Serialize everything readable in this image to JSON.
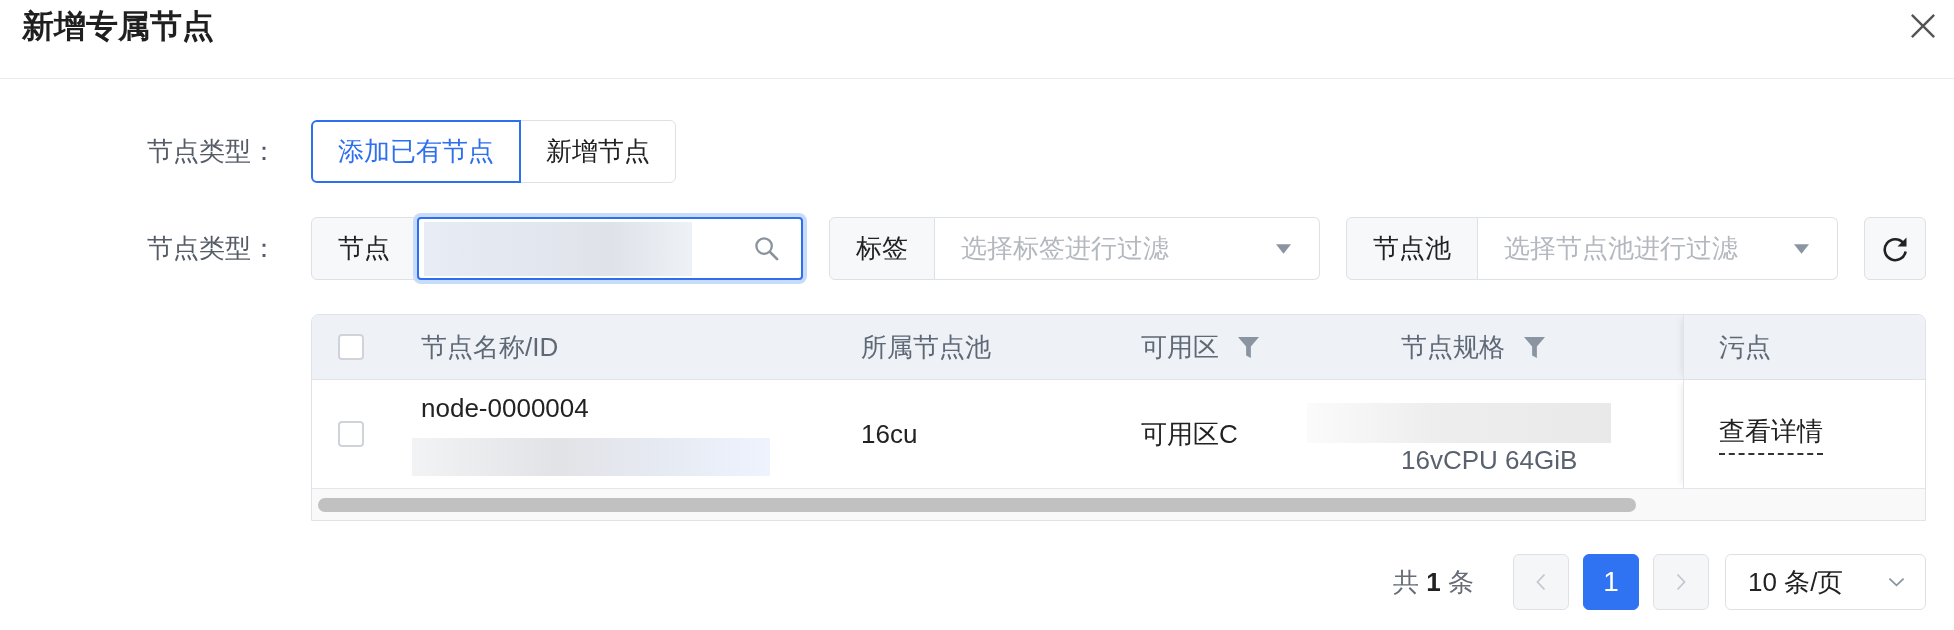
{
  "dialog": {
    "title": "新增专属节点"
  },
  "node_type": {
    "label": "节点类型：",
    "options": [
      {
        "label": "添加已有节点",
        "selected": true
      },
      {
        "label": "新增节点",
        "selected": false
      }
    ]
  },
  "filters": {
    "label": "节点类型：",
    "node": {
      "addon": "节点",
      "focused": true,
      "value_blurred": true
    },
    "tag": {
      "addon": "标签",
      "placeholder": "选择标签进行过滤"
    },
    "pool": {
      "addon": "节点池",
      "placeholder": "选择节点池进行过滤"
    }
  },
  "table": {
    "header_checked": false,
    "columns": [
      {
        "label": "节点名称/ID",
        "filterable": false
      },
      {
        "label": "所属节点池",
        "filterable": false
      },
      {
        "label": "可用区",
        "filterable": true
      },
      {
        "label": "节点规格",
        "filterable": true
      },
      {
        "label": "污点",
        "filterable": false
      }
    ],
    "rows": [
      {
        "checked": false,
        "name": "node-0000004",
        "id_blurred": true,
        "pool": "16cu",
        "zone": "可用区C",
        "spec_blurred": true,
        "spec": "16vCPU 64GiB",
        "taints": "查看详情"
      }
    ]
  },
  "pagination": {
    "total": "共 **1** 条",
    "prev_disabled": true,
    "pages": [
      {
        "label": "1",
        "selected": true
      }
    ],
    "next_disabled": true,
    "page_size": "10 条/页"
  }
}
